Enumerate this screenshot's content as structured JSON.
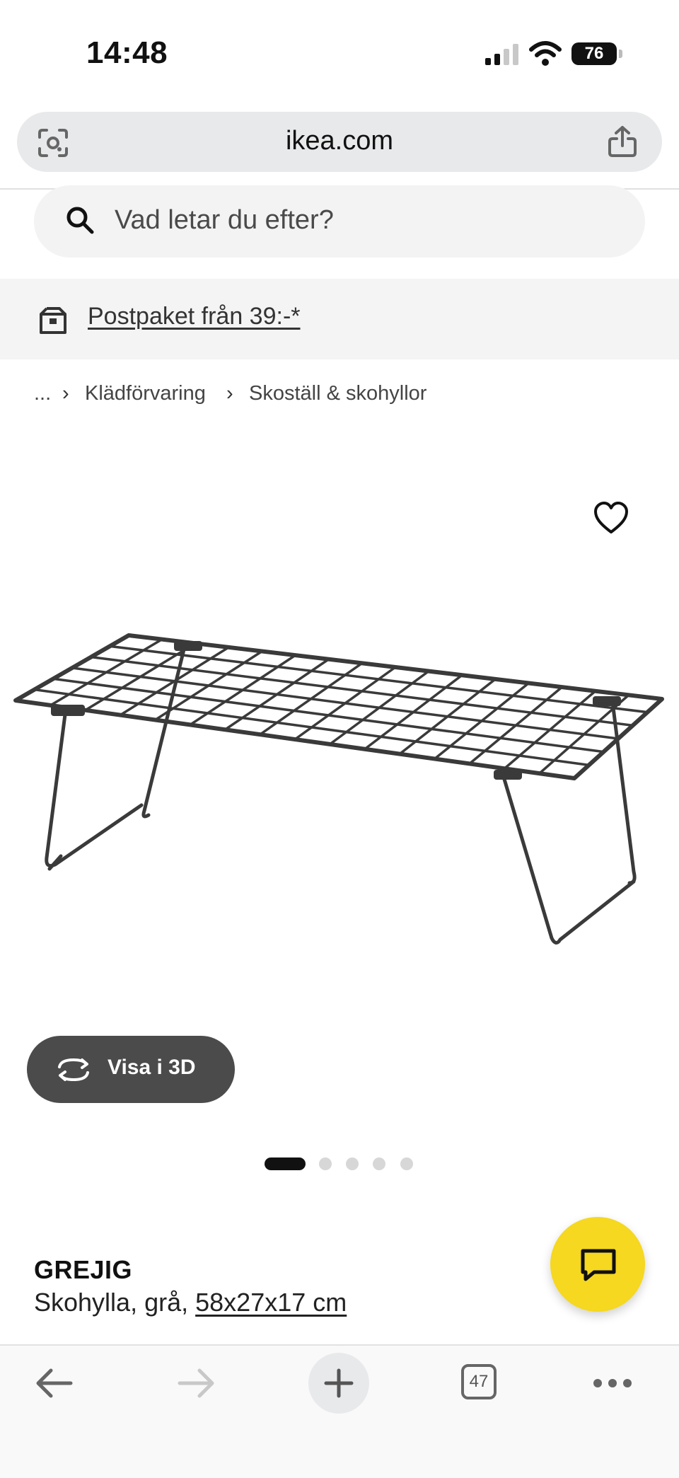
{
  "status_bar": {
    "time": "14:48",
    "battery": "76"
  },
  "browser": {
    "url": "ikea.com",
    "tab_count": "47"
  },
  "search": {
    "placeholder": "Vad letar du efter?"
  },
  "promo": {
    "text": "Postpaket från 39:-*"
  },
  "breadcrumb": {
    "items": [
      "...",
      "Klädförvaring",
      "Skoställ & skohyllor"
    ]
  },
  "product": {
    "name": "GREJIG",
    "description": "Skohylla, grå, ",
    "dimensions": "58x27x17 cm",
    "view_3d_label": "Visa i 3D",
    "image_count": 5,
    "active_image": 1
  },
  "colors": {
    "accent_yellow": "#f5d81f",
    "button_dark": "#4b4b4b",
    "product_gray": "#3a3a3a"
  },
  "icons": [
    "lens-icon",
    "share-icon",
    "search-icon",
    "parcel-icon",
    "heart-icon",
    "rotate-3d-icon",
    "chat-icon",
    "back-arrow-icon",
    "forward-arrow-icon",
    "plus-icon",
    "tabs-icon",
    "more-icon"
  ]
}
